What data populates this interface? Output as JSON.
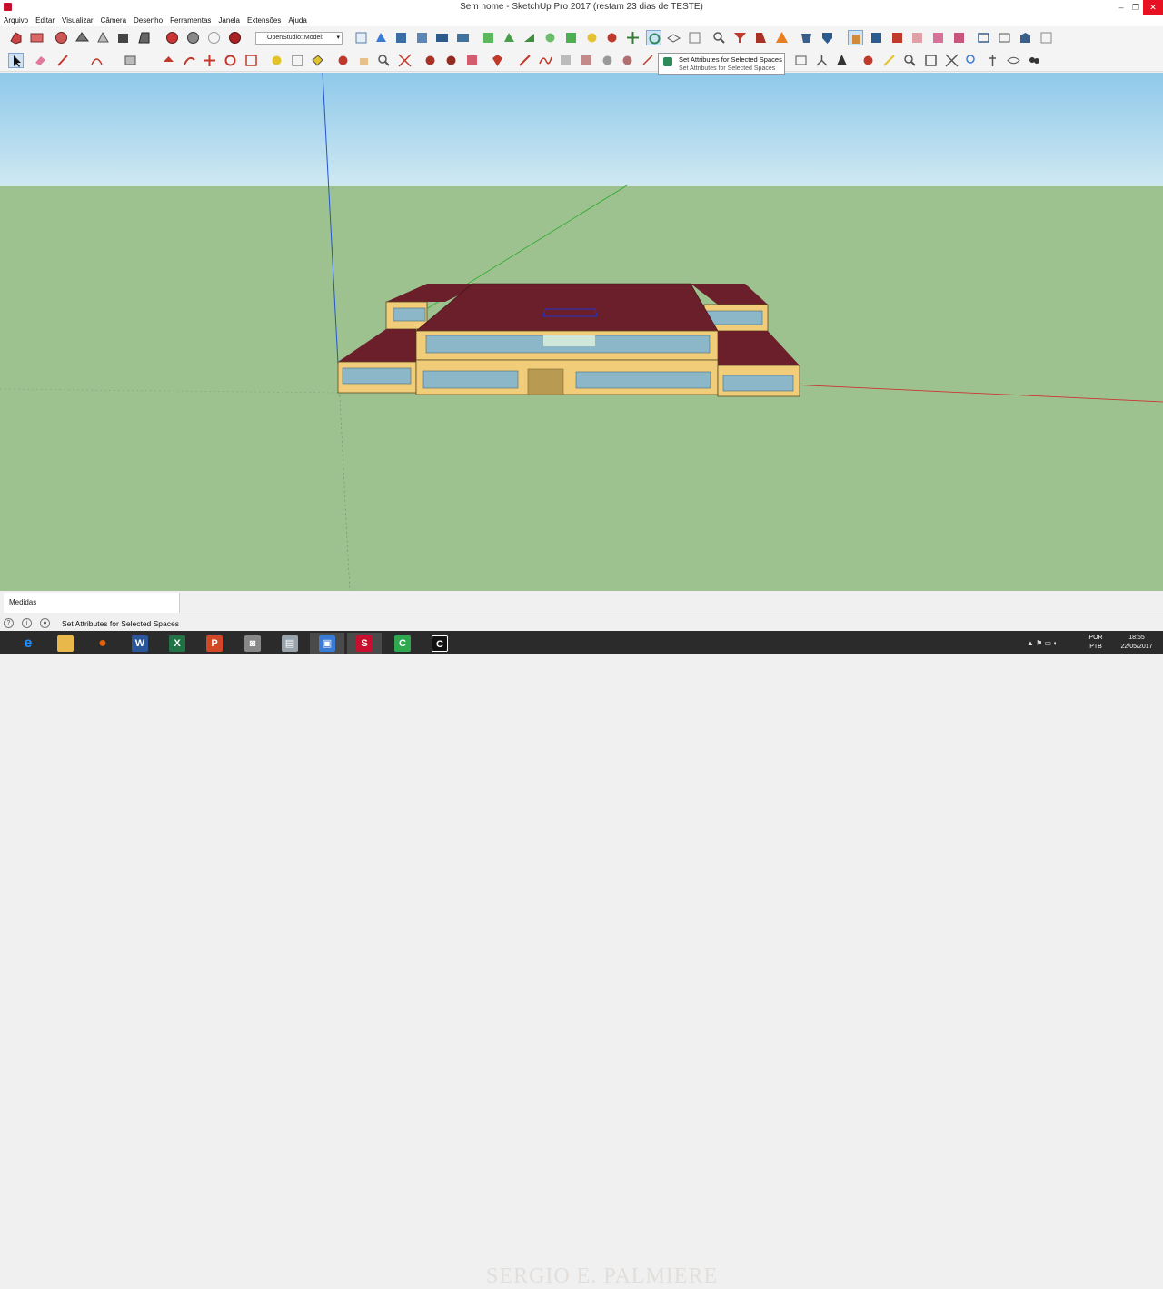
{
  "window": {
    "title": "Sem nome - SketchUp Pro 2017 (restam 23 dias de TESTE)",
    "minimize_glyph": "–",
    "restore_glyph": "❐",
    "close_glyph": "✕"
  },
  "menu": [
    "Arquivo",
    "Editar",
    "Visualizar",
    "Câmera",
    "Desenho",
    "Ferramentas",
    "Janela",
    "Extensões",
    "Ajuda"
  ],
  "toolbar": {
    "openstudio_dropdown": "OpenStudio::Model:",
    "dropdown_arrow": "▾"
  },
  "tooltip": {
    "title": "Set Attributes for Selected Spaces",
    "subtitle": "Set Attributes for Selected Spaces"
  },
  "measures": {
    "label": "Medidas"
  },
  "status": {
    "text": "Set Attributes for Selected Spaces",
    "help_glyph": "?",
    "info_glyph": "i",
    "person_glyph": "●"
  },
  "taskbar": {
    "apps": [
      {
        "name": "ie",
        "glyph": "e",
        "color": "#1e90ff"
      },
      {
        "name": "explorer",
        "glyph": "▆",
        "color": "#e8b84a"
      },
      {
        "name": "firefox",
        "glyph": "●",
        "color": "#e66000"
      },
      {
        "name": "word",
        "glyph": "W",
        "color": "#2b579a"
      },
      {
        "name": "excel",
        "glyph": "X",
        "color": "#217346"
      },
      {
        "name": "powerpoint",
        "glyph": "P",
        "color": "#d24726"
      },
      {
        "name": "camera",
        "glyph": "◙",
        "color": "#888888"
      },
      {
        "name": "printer",
        "glyph": "▤",
        "color": "#9aa4ad"
      },
      {
        "name": "screen",
        "glyph": "▣",
        "color": "#3a7bd5"
      },
      {
        "name": "sketchup",
        "glyph": "S",
        "color": "#c8102e"
      },
      {
        "name": "camtasia",
        "glyph": "C",
        "color": "#2fa84f"
      },
      {
        "name": "recorder",
        "glyph": "C",
        "color": "#1a1a1a"
      }
    ],
    "watermark": "SERGIO E. PALMIERE",
    "language": "POR",
    "keyboard": "PTB",
    "time": "18:55",
    "date": "22/05/2017",
    "tray_glyphs": "▲ ⚑ ▭ ◐"
  },
  "colors": {
    "sky": "#a9d7ef",
    "ground": "#9dc28f",
    "roof": "#6b1f2a",
    "wall": "#f1cd7a",
    "window": "#8cb7c9",
    "door": "#b99a52"
  }
}
